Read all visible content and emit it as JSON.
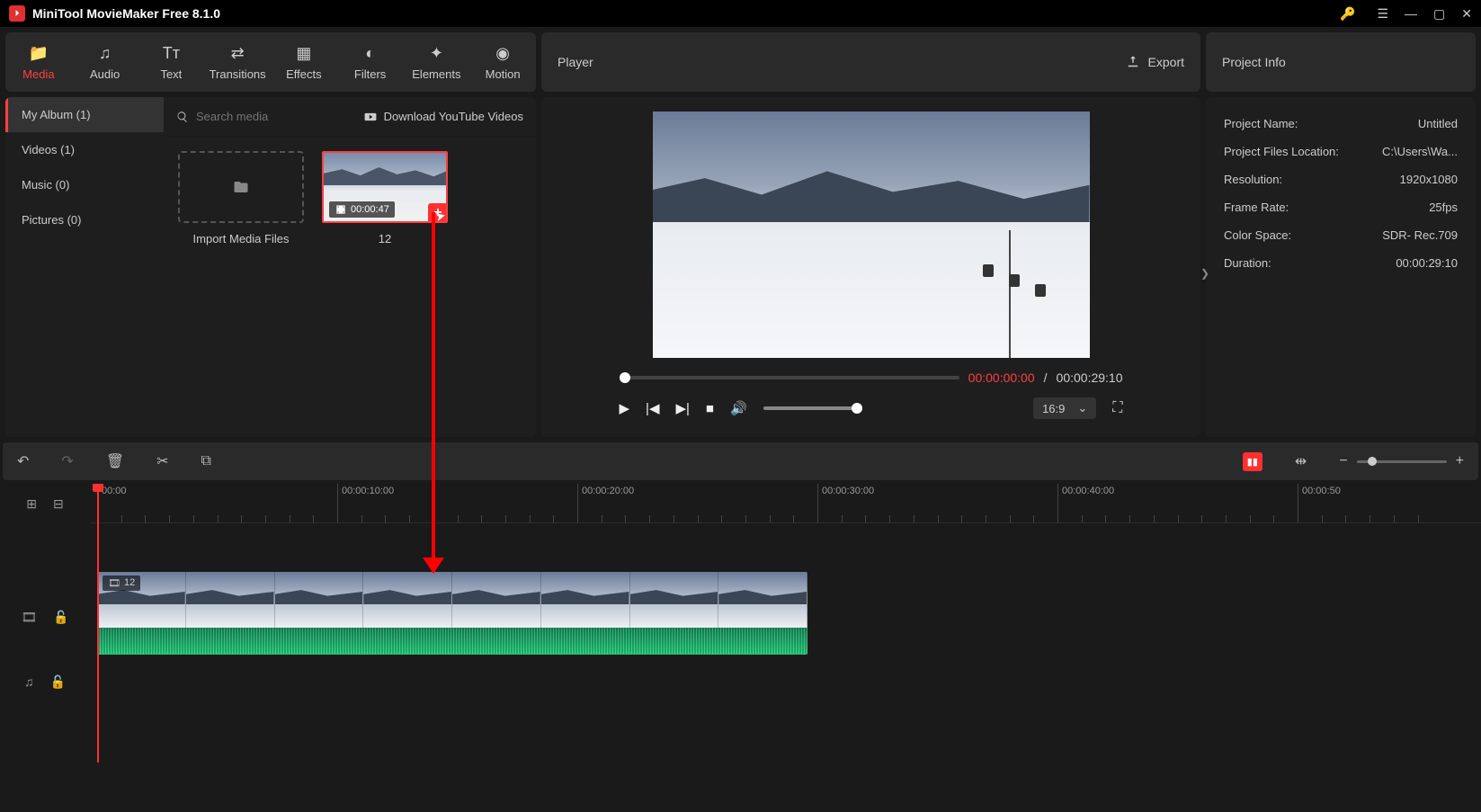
{
  "title": "MiniTool MovieMaker Free 8.1.0",
  "toolbar": [
    {
      "label": "Media",
      "active": true
    },
    {
      "label": "Audio"
    },
    {
      "label": "Text"
    },
    {
      "label": "Transitions"
    },
    {
      "label": "Effects"
    },
    {
      "label": "Filters"
    },
    {
      "label": "Elements"
    },
    {
      "label": "Motion"
    }
  ],
  "player_header": "Player",
  "export_label": "Export",
  "info_header": "Project Info",
  "sidebar": {
    "album": "My Album (1)",
    "videos": "Videos (1)",
    "music": "Music (0)",
    "pictures": "Pictures (0)"
  },
  "search_placeholder": "Search media",
  "download_yt": "Download YouTube Videos",
  "import_label": "Import Media Files",
  "clip": {
    "duration": "00:00:47",
    "name": "12"
  },
  "playback": {
    "current": "00:00:00:00",
    "sep": " / ",
    "total": "00:00:29:10",
    "ratio": "16:9"
  },
  "project": {
    "name_k": "Project Name:",
    "name_v": "Untitled",
    "loc_k": "Project Files Location:",
    "loc_v": "C:\\Users\\Wa...",
    "res_k": "Resolution:",
    "res_v": "1920x1080",
    "fr_k": "Frame Rate:",
    "fr_v": "25fps",
    "cs_k": "Color Space:",
    "cs_v": "SDR- Rec.709",
    "dur_k": "Duration:",
    "dur_v": "00:00:29:10"
  },
  "ruler": [
    "00:00",
    "00:00:10:00",
    "00:00:20:00",
    "00:00:30:00",
    "00:00:40:00",
    "00:00:50"
  ],
  "timeline_clip": "12"
}
